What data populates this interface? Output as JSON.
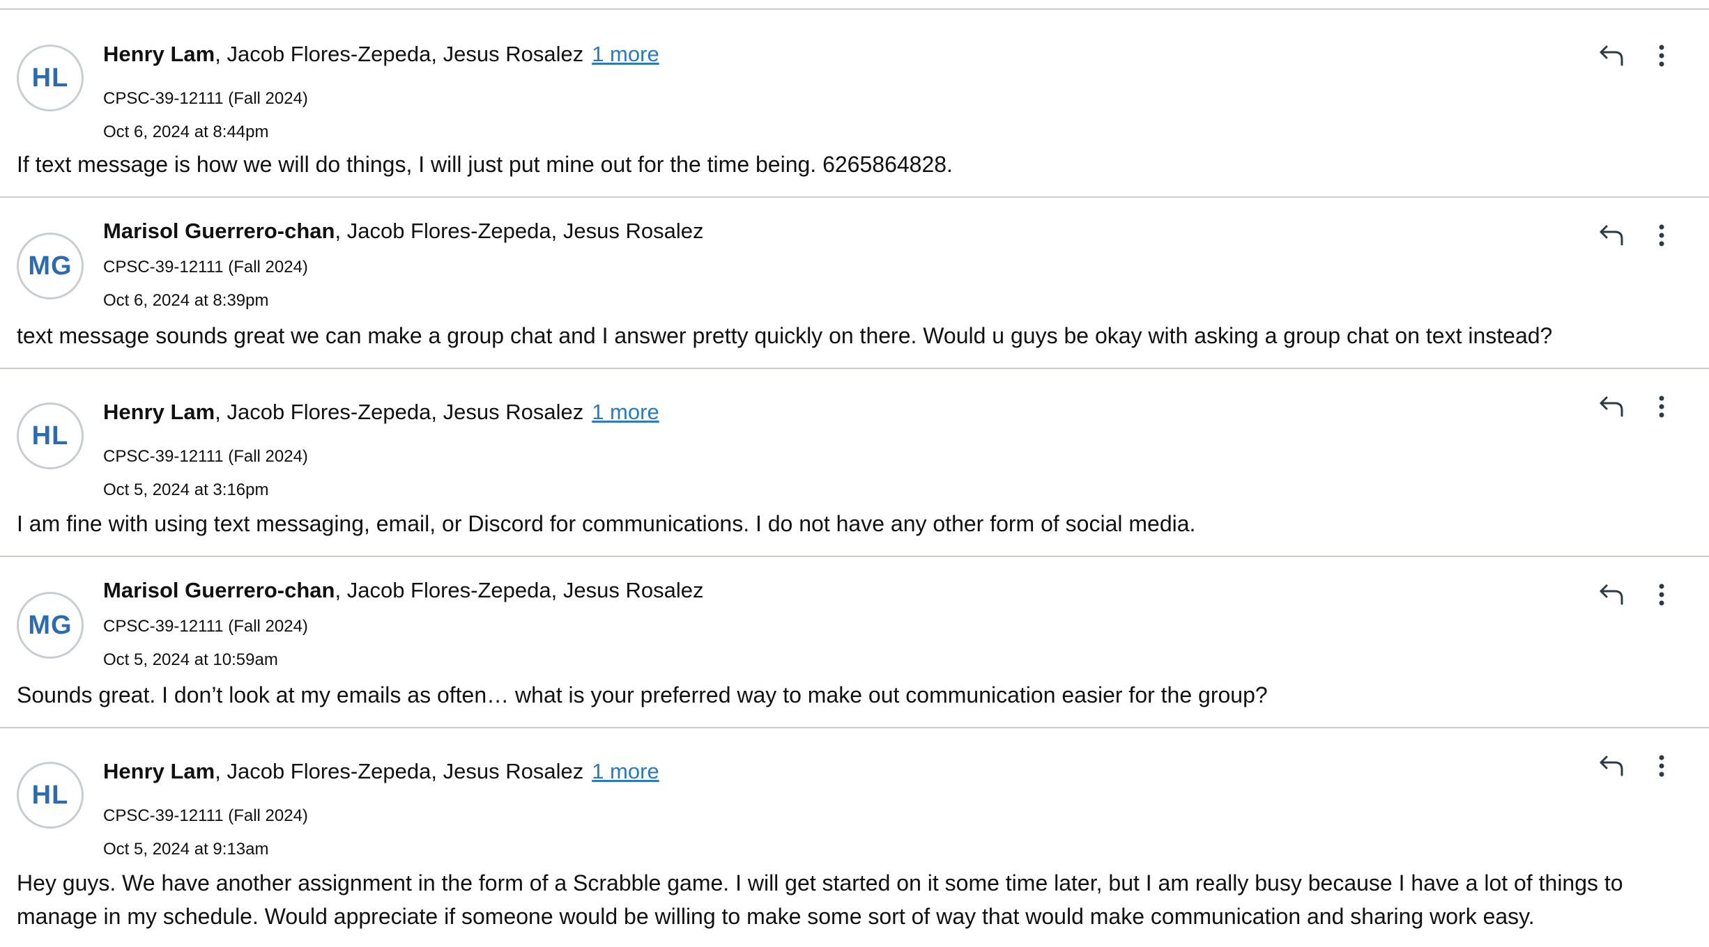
{
  "messages": [
    {
      "initials": "HL",
      "author": "Henry Lam",
      "others": ", Jacob Flores-Zepeda, Jesus Rosalez",
      "more_link": "1 more",
      "course": "CPSC-39-12111 (Fall 2024)",
      "date": "Oct 6, 2024 at 8:44pm",
      "body": "If text message is how we will do things, I will just put mine out for the time being. 6265864828."
    },
    {
      "initials": "MG",
      "author": "Marisol Guerrero-chan",
      "others": ", Jacob Flores-Zepeda, Jesus Rosalez",
      "more_link": "",
      "course": "CPSC-39-12111 (Fall 2024)",
      "date": "Oct 6, 2024 at 8:39pm",
      "body": "text message sounds great we can make a group chat and I answer pretty quickly on there. Would u guys be okay with asking a group chat on text instead?"
    },
    {
      "initials": "HL",
      "author": "Henry Lam",
      "others": ", Jacob Flores-Zepeda, Jesus Rosalez",
      "more_link": "1 more",
      "course": "CPSC-39-12111 (Fall 2024)",
      "date": "Oct 5, 2024 at 3:16pm",
      "body": "I am fine with using text messaging, email, or Discord for communications. I do not have any other form of social media."
    },
    {
      "initials": "MG",
      "author": "Marisol Guerrero-chan",
      "others": ", Jacob Flores-Zepeda, Jesus Rosalez",
      "more_link": "",
      "course": "CPSC-39-12111 (Fall 2024)",
      "date": "Oct 5, 2024 at 10:59am",
      "body": "Sounds great. I don’t look at my emails as often… what is your preferred way to make out communication easier for the group?"
    },
    {
      "initials": "HL",
      "author": "Henry Lam",
      "others": ", Jacob Flores-Zepeda, Jesus Rosalez",
      "more_link": "1 more",
      "course": "CPSC-39-12111 (Fall 2024)",
      "date": "Oct 5, 2024 at 9:13am",
      "body": "Hey guys. We have another assignment in the form of a Scrabble game. I will get started on it some time later, but I am really busy because I have a lot of things to manage in my schedule. Would appreciate if someone would be willing to make some sort of way that would make communication and sharing work easy."
    }
  ],
  "colors": {
    "avatar_text": "#2b6cb0",
    "link": "#2b7abc",
    "divider": "#c7cdd1",
    "icon": "#2d3b45"
  },
  "icons": {
    "reply": "reply-arrow-icon",
    "more": "vertical-ellipsis-icon"
  }
}
